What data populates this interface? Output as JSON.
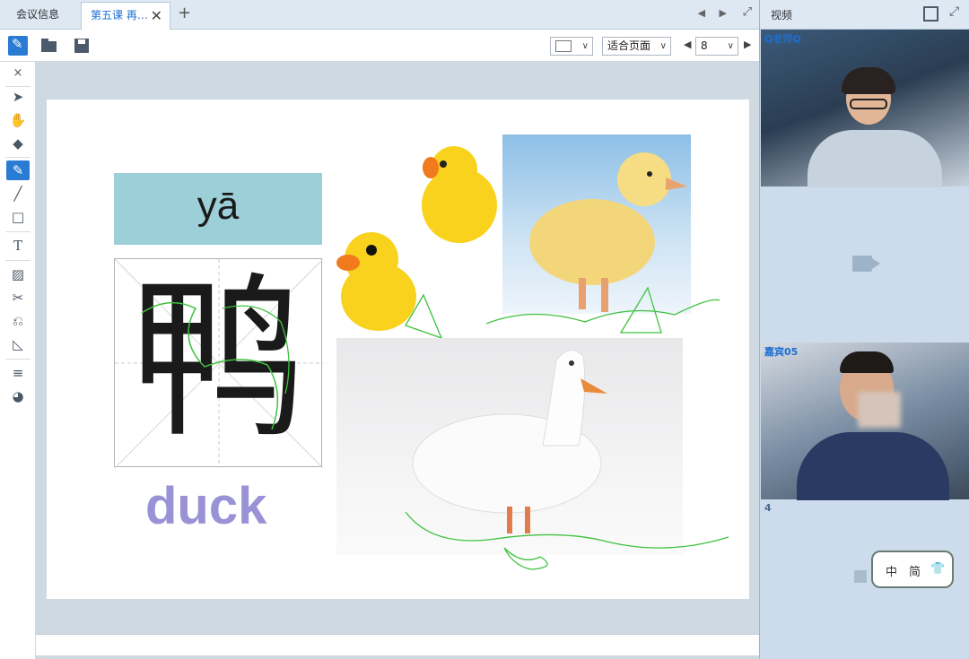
{
  "tabs": [
    {
      "label": "会议信息"
    },
    {
      "label": "第五课  再…",
      "close": "✕"
    }
  ],
  "tab_add": "+",
  "tab_nav": "◀ ▶",
  "toolbar": {
    "zoom_value": "适合页面",
    "page_value": "8",
    "page_prev": "◀",
    "page_next": "▶"
  },
  "tools_close": "×",
  "slide": {
    "pinyin": "yā",
    "hanzi": "鸭",
    "english": "duck",
    "colors": {
      "pinyin_box": "#9ccfd7",
      "english": "#9a92d6",
      "annotation": "#3fc23f"
    }
  },
  "video": {
    "title": "视频",
    "slots": [
      {
        "label": "Q老师Q"
      },
      {
        "label": ""
      },
      {
        "label": "嘉宾05"
      },
      {
        "label": "4"
      }
    ],
    "lang_badge": {
      "zh": "中",
      "jian": "简",
      "icon": "shirt-icon"
    }
  }
}
